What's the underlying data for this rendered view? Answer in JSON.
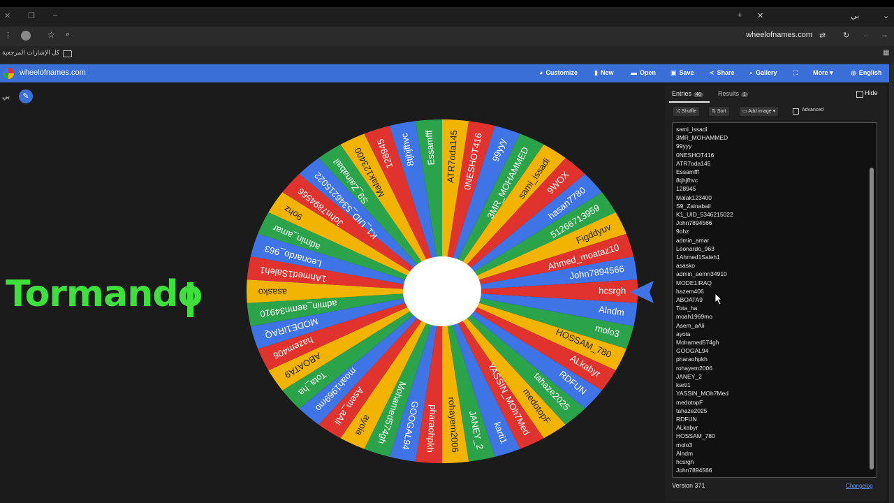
{
  "browser": {
    "url": "wheelofnames.com",
    "bookmark_folder_label": "كل الإشارات المرجعية",
    "profile_label": "بي"
  },
  "app": {
    "brand": "wheelofnames.com",
    "menu": [
      {
        "label": "Customize",
        "icon": "palette-icon"
      },
      {
        "label": "New",
        "icon": "file-icon"
      },
      {
        "label": "Open",
        "icon": "folder-icon"
      },
      {
        "label": "Save",
        "icon": "save-icon"
      },
      {
        "label": "Share",
        "icon": "share-icon"
      },
      {
        "label": "Gallery",
        "icon": "search-icon"
      },
      {
        "label": "",
        "icon": "fullscreen-icon"
      },
      {
        "label": "More ▾",
        "icon": ""
      },
      {
        "label": "English",
        "icon": "globe-icon"
      }
    ]
  },
  "overlay": {
    "edit_label": "بي",
    "tormando_text": "Tormando"
  },
  "panel": {
    "tabs": [
      {
        "label": "Entries",
        "badge": "46"
      },
      {
        "label": "Results",
        "badge": "1"
      }
    ],
    "hide_label": "Hide",
    "tools": [
      "Shuffle",
      "Sort",
      "Add image ▾"
    ],
    "advanced_label": "Advanced",
    "version": "Version 371",
    "changelog": "Changelog"
  },
  "entries": [
    "sami_issadi",
    "3MR_MOHAMMED",
    "99yyy",
    "0NESHOT416",
    "ATR7oda145",
    "Essamfff",
    "8tjhjfhvc",
    "128945",
    "Malak123400",
    "S9_Zainabail",
    "K1_UID_5346215022",
    "John7894566",
    "9ohz",
    "admin_amar",
    "Leonardo_963",
    "1Ahmed1Saleh1",
    "asasko",
    "admin_aemn34910",
    "MODE1IRAQ",
    "hazem406",
    "ABOATA9",
    "Tota_ha",
    "moah1969mo",
    "Asem_aAli",
    "ayoia",
    "Mohamed574gh",
    "GOOGAL94",
    "pharaohpkh",
    "rohayem2006",
    "JANEY_2",
    "karti1",
    "YASSIN_MOh7Med",
    "medotopF",
    "tahaze2025",
    "RDFUN",
    "ALkabyr",
    "HOSSAM_780",
    "molo3",
    "Alndm",
    "hcsrgh",
    "John7894566"
  ],
  "wheel": {
    "colors": [
      "#e0332e",
      "#3f74e6",
      "#2aa34a",
      "#f2b400"
    ],
    "selected": "hcsrgh",
    "labels": [
      "hcsrgh",
      "Alndm",
      "molo3",
      "HOSSAM_780",
      "ALkabyr",
      "RDFUN",
      "tahaze2025",
      "medotopF",
      "YASSIN_MOh7Med",
      "karti1",
      "JANEY_2",
      "rohayem2006",
      "pharaohpkh",
      "GOOGAL94",
      "Mohamed574gh",
      "ayoia",
      "Asem_aAli",
      "moah1969mo",
      "Tota_ha",
      "ABOATA9",
      "hazem406",
      "MODE1IRAQ",
      "admin_aemn34910",
      "asasko",
      "1Ahmed1Saleh1",
      "Leonardo_963",
      "admin_amar",
      "9ohz",
      "John7894566",
      "K1_UID_5346215022",
      "S9_Zainabail",
      "Malak123400",
      "128945",
      "8tjhjfhvc",
      "Essamfff",
      "ATR7oda145",
      "0NESHOT416",
      "99yyy",
      "3MR_MOHAMMED",
      "sami_issadi",
      "9WOX",
      "hasan7780",
      "51266713959",
      "Figddyuv",
      "Ahmed_moataz10",
      "John7894566"
    ]
  }
}
